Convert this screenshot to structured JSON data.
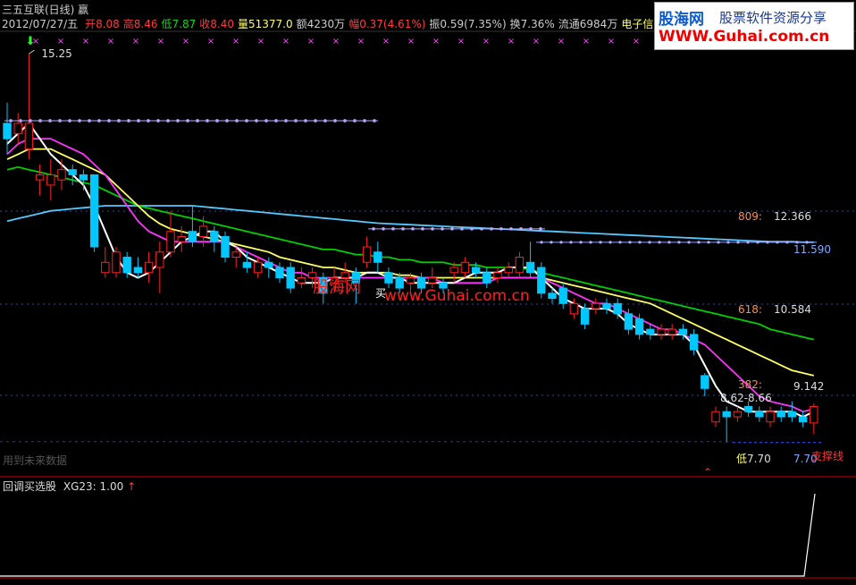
{
  "window": {
    "title": "三五互联(日线) 赢",
    "date": "2012/07/27/五"
  },
  "quote": [
    {
      "label": "开",
      "value": "8.08",
      "label_color": "#ff3b3b",
      "value_color": "#ff3b3b"
    },
    {
      "label": "高",
      "value": "8.46",
      "label_color": "#ff3b3b",
      "value_color": "#ff3b3b"
    },
    {
      "label": "低",
      "value": "7.87",
      "label_color": "#00e000",
      "value_color": "#00e000"
    },
    {
      "label": "收",
      "value": "8.40",
      "label_color": "#ff3b3b",
      "value_color": "#ff3b3b"
    },
    {
      "label": "量",
      "value": "51377.0",
      "label_color": "#ffff66",
      "value_color": "#ffff66"
    },
    {
      "label": "额",
      "value": "4230万",
      "label_color": "#cccccc",
      "value_color": "#cccccc"
    },
    {
      "label": "幅",
      "value": "0.37(4.61%)",
      "label_color": "#ff3b3b",
      "value_color": "#ff3b3b"
    },
    {
      "label": "振",
      "value": "0.59(7.35%)",
      "label_color": "#cccccc",
      "value_color": "#cccccc"
    },
    {
      "label": "换",
      "value": "7.36%",
      "label_color": "#cccccc",
      "value_color": "#cccccc"
    },
    {
      "label": "流通",
      "value": "6984万",
      "label_color": "#cccccc",
      "value_color": "#cccccc"
    },
    {
      "label": "",
      "value": "电子信息",
      "label_color": "#ffff66",
      "value_color": "#ffff66"
    }
  ],
  "watermark": {
    "site_name": "股海网",
    "slogan": "股票软件资源分享",
    "url": "WWW.Guhai.com.cn",
    "center_name": "股海网",
    "center_url": "www.Guhai.com.cn"
  },
  "main_panel": {
    "price_marks": {
      "peak": "15.25",
      "fib809_label": "809:",
      "fib809_value": "12.366",
      "level_11590": "11.590",
      "fib618_label": "618:",
      "fib618_value": "10.584",
      "fib382_label": "382:",
      "fib382_value": "9.142",
      "range_label": "8.62-8.66",
      "low_marker": "低",
      "low_value": "7.70",
      "low_value_right": "7.70",
      "buy_label": "买",
      "support_label": "支撑线",
      "future_note": "用到未来数据"
    }
  },
  "indicator_panel": {
    "name": "回调买选股",
    "series_label": "XG23:",
    "series_value": "1.00",
    "arrow": "↑"
  },
  "colors": {
    "up": "#ff2020",
    "down": "#00c8ff",
    "white_ma": "#ffffff",
    "magenta_ma": "#ff33ff",
    "yellow_ma": "#ffff66",
    "green_ma": "#00d000",
    "cyan_ma": "#55c8ff",
    "dot_line": "#b8a8ff",
    "frame": "#cc0000"
  },
  "chart_data": {
    "type": "candlestick",
    "ylim": [
      7.4,
      15.6
    ],
    "candles": [
      {
        "o": 13.9,
        "c": 13.6,
        "h": 14.3,
        "l": 13.3
      },
      {
        "o": 13.7,
        "c": 13.9,
        "h": 14.1,
        "l": 13.5
      },
      {
        "o": 13.4,
        "c": 13.9,
        "h": 15.25,
        "l": 13.2
      },
      {
        "o": 12.8,
        "c": 12.9,
        "h": 13.1,
        "l": 12.5
      },
      {
        "o": 12.7,
        "c": 12.9,
        "h": 13.2,
        "l": 12.4
      },
      {
        "o": 12.8,
        "c": 13.0,
        "h": 13.2,
        "l": 12.6
      },
      {
        "o": 13.0,
        "c": 12.9,
        "h": 13.1,
        "l": 12.7
      },
      {
        "o": 12.9,
        "c": 12.8,
        "h": 13.0,
        "l": 12.6
      },
      {
        "o": 12.9,
        "c": 11.5,
        "h": 12.9,
        "l": 11.4
      },
      {
        "o": 11.0,
        "c": 11.2,
        "h": 11.5,
        "l": 10.9
      },
      {
        "o": 11.0,
        "c": 11.4,
        "h": 11.5,
        "l": 10.9
      },
      {
        "o": 11.3,
        "c": 11.0,
        "h": 11.4,
        "l": 10.9
      },
      {
        "o": 11.1,
        "c": 11.0,
        "h": 11.3,
        "l": 10.9
      },
      {
        "o": 11.0,
        "c": 11.2,
        "h": 11.4,
        "l": 10.8
      },
      {
        "o": 11.1,
        "c": 11.4,
        "h": 11.6,
        "l": 10.6
      },
      {
        "o": 11.4,
        "c": 11.8,
        "h": 12.2,
        "l": 11.3
      },
      {
        "o": 11.6,
        "c": 11.7,
        "h": 11.9,
        "l": 11.4
      },
      {
        "o": 11.8,
        "c": 11.6,
        "h": 12.3,
        "l": 11.5
      },
      {
        "o": 11.7,
        "c": 11.9,
        "h": 12.1,
        "l": 11.5
      },
      {
        "o": 11.8,
        "c": 11.6,
        "h": 11.9,
        "l": 11.4
      },
      {
        "o": 11.7,
        "c": 11.3,
        "h": 11.8,
        "l": 11.2
      },
      {
        "o": 11.3,
        "c": 11.4,
        "h": 11.5,
        "l": 11.1
      },
      {
        "o": 11.2,
        "c": 11.1,
        "h": 11.4,
        "l": 11.0
      },
      {
        "o": 11.0,
        "c": 11.2,
        "h": 11.3,
        "l": 10.9
      },
      {
        "o": 11.2,
        "c": 11.1,
        "h": 11.3,
        "l": 10.9
      },
      {
        "o": 11.1,
        "c": 10.9,
        "h": 11.2,
        "l": 10.8
      },
      {
        "o": 11.1,
        "c": 10.7,
        "h": 11.2,
        "l": 10.6
      },
      {
        "o": 10.8,
        "c": 10.9,
        "h": 11.1,
        "l": 10.7
      },
      {
        "o": 10.9,
        "c": 11.0,
        "h": 11.1,
        "l": 10.7
      },
      {
        "o": 10.9,
        "c": 10.6,
        "h": 11.0,
        "l": 10.4
      },
      {
        "o": 10.8,
        "c": 10.9,
        "h": 11.1,
        "l": 10.6
      },
      {
        "o": 10.9,
        "c": 11.0,
        "h": 11.2,
        "l": 10.8
      },
      {
        "o": 11.0,
        "c": 10.8,
        "h": 11.1,
        "l": 10.4
      },
      {
        "o": 11.2,
        "c": 11.5,
        "h": 11.7,
        "l": 11.1
      },
      {
        "o": 11.4,
        "c": 11.2,
        "h": 11.6,
        "l": 11.0
      },
      {
        "o": 11.0,
        "c": 10.8,
        "h": 11.1,
        "l": 10.7
      },
      {
        "o": 10.9,
        "c": 10.7,
        "h": 11.0,
        "l": 10.6
      },
      {
        "o": 10.8,
        "c": 10.9,
        "h": 11.0,
        "l": 10.6
      },
      {
        "o": 10.9,
        "c": 10.7,
        "h": 11.0,
        "l": 10.6
      },
      {
        "o": 10.8,
        "c": 10.9,
        "h": 11.1,
        "l": 10.7
      },
      {
        "o": 10.8,
        "c": 10.7,
        "h": 10.9,
        "l": 10.6
      },
      {
        "o": 11.0,
        "c": 11.1,
        "h": 11.2,
        "l": 10.8
      },
      {
        "o": 11.0,
        "c": 11.2,
        "h": 11.3,
        "l": 10.9
      },
      {
        "o": 11.1,
        "c": 11.0,
        "h": 11.2,
        "l": 10.9
      },
      {
        "o": 11.0,
        "c": 10.8,
        "h": 11.1,
        "l": 10.7
      },
      {
        "o": 10.9,
        "c": 11.0,
        "h": 11.1,
        "l": 10.8
      },
      {
        "o": 11.0,
        "c": 11.1,
        "h": 11.2,
        "l": 10.9
      },
      {
        "o": 11.0,
        "c": 11.3,
        "h": 11.4,
        "l": 10.9
      },
      {
        "o": 11.2,
        "c": 11.0,
        "h": 11.6,
        "l": 10.9
      },
      {
        "o": 11.1,
        "c": 10.6,
        "h": 11.2,
        "l": 10.5
      },
      {
        "o": 10.6,
        "c": 10.5,
        "h": 10.7,
        "l": 10.4
      },
      {
        "o": 10.7,
        "c": 10.4,
        "h": 10.8,
        "l": 10.3
      },
      {
        "o": 10.2,
        "c": 10.4,
        "h": 10.5,
        "l": 10.1
      },
      {
        "o": 10.3,
        "c": 10.0,
        "h": 10.4,
        "l": 9.9
      },
      {
        "o": 10.3,
        "c": 10.4,
        "h": 10.5,
        "l": 10.2
      },
      {
        "o": 10.4,
        "c": 10.3,
        "h": 10.5,
        "l": 10.2
      },
      {
        "o": 10.4,
        "c": 10.2,
        "h": 10.5,
        "l": 10.1
      },
      {
        "o": 10.2,
        "c": 9.9,
        "h": 10.3,
        "l": 9.8
      },
      {
        "o": 10.1,
        "c": 9.8,
        "h": 10.2,
        "l": 9.7
      },
      {
        "o": 9.9,
        "c": 9.8,
        "h": 10.0,
        "l": 9.7
      },
      {
        "o": 9.8,
        "c": 9.9,
        "h": 10.0,
        "l": 9.7
      },
      {
        "o": 9.8,
        "c": 9.9,
        "h": 10.0,
        "l": 9.7
      },
      {
        "o": 9.9,
        "c": 9.8,
        "h": 10.0,
        "l": 9.7
      },
      {
        "o": 9.8,
        "c": 9.5,
        "h": 9.9,
        "l": 9.4
      },
      {
        "o": 9.0,
        "c": 8.75,
        "h": 9.05,
        "l": 8.6
      },
      {
        "o": 8.1,
        "c": 8.3,
        "h": 8.4,
        "l": 8.0
      },
      {
        "o": 8.3,
        "c": 8.2,
        "h": 8.4,
        "l": 7.7
      },
      {
        "o": 8.2,
        "c": 8.3,
        "h": 8.4,
        "l": 8.1
      },
      {
        "o": 8.4,
        "c": 8.3,
        "h": 8.5,
        "l": 8.2
      },
      {
        "o": 8.3,
        "c": 8.2,
        "h": 8.4,
        "l": 8.1
      },
      {
        "o": 8.1,
        "c": 8.3,
        "h": 8.4,
        "l": 8.0
      },
      {
        "o": 8.3,
        "c": 8.2,
        "h": 8.4,
        "l": 8.1
      },
      {
        "o": 8.3,
        "c": 8.2,
        "h": 8.5,
        "l": 8.1
      },
      {
        "o": 8.2,
        "c": 8.1,
        "h": 8.3,
        "l": 8.0
      },
      {
        "o": 8.08,
        "c": 8.4,
        "h": 8.46,
        "l": 7.87
      }
    ],
    "ma_white": [
      13.5,
      13.7,
      13.9,
      13.6,
      13.3,
      13.1,
      12.9,
      12.7,
      12.3,
      11.8,
      11.3,
      11.0,
      10.9,
      11.0,
      11.2,
      11.4,
      11.6,
      11.7,
      11.8,
      11.8,
      11.6,
      11.5,
      11.3,
      11.2,
      11.1,
      11.0,
      10.9,
      10.8,
      10.8,
      10.8,
      10.9,
      10.9,
      10.9,
      11.0,
      11.0,
      10.9,
      10.9,
      10.8,
      10.8,
      10.8,
      10.8,
      10.8,
      10.9,
      11.0,
      11.0,
      11.0,
      11.1,
      11.1,
      11.1,
      10.9,
      10.7,
      10.5,
      10.4,
      10.3,
      10.3,
      10.3,
      10.2,
      10.0,
      9.9,
      9.8,
      9.8,
      9.8,
      9.8,
      9.6,
      9.2,
      8.8,
      8.5,
      8.4,
      8.3,
      8.3,
      8.3,
      8.3,
      8.3,
      8.2,
      8.3
    ],
    "ma_magenta": [
      13.3,
      13.5,
      13.6,
      13.6,
      13.6,
      13.5,
      13.4,
      13.3,
      13.1,
      12.9,
      12.6,
      12.3,
      12.0,
      11.8,
      11.7,
      11.6,
      11.6,
      11.6,
      11.6,
      11.6,
      11.6,
      11.5,
      11.4,
      11.3,
      11.2,
      11.1,
      11.0,
      11.0,
      10.9,
      10.9,
      10.9,
      10.9,
      10.9,
      10.9,
      10.9,
      10.9,
      10.9,
      10.9,
      10.9,
      10.9,
      10.8,
      10.8,
      10.8,
      10.8,
      10.8,
      10.9,
      10.9,
      10.9,
      10.9,
      10.9,
      10.8,
      10.7,
      10.6,
      10.5,
      10.4,
      10.4,
      10.3,
      10.2,
      10.1,
      10.0,
      9.9,
      9.9,
      9.8,
      9.7,
      9.6,
      9.4,
      9.2,
      9.0,
      8.8,
      8.6,
      8.5,
      8.45,
      8.4,
      8.3,
      8.35
    ],
    "ma_yellow": [
      13.2,
      13.3,
      13.4,
      13.4,
      13.4,
      13.3,
      13.2,
      13.1,
      13.0,
      12.9,
      12.7,
      12.5,
      12.3,
      12.1,
      11.95,
      11.85,
      11.8,
      11.75,
      11.7,
      11.65,
      11.6,
      11.55,
      11.5,
      11.45,
      11.4,
      11.3,
      11.25,
      11.2,
      11.15,
      11.1,
      11.1,
      11.05,
      11.0,
      11.0,
      11.0,
      11.0,
      10.95,
      10.95,
      10.9,
      10.9,
      10.9,
      10.9,
      10.9,
      10.9,
      10.9,
      10.9,
      10.9,
      10.9,
      10.9,
      10.9,
      10.85,
      10.8,
      10.75,
      10.7,
      10.65,
      10.6,
      10.55,
      10.5,
      10.45,
      10.4,
      10.3,
      10.2,
      10.1,
      10.0,
      9.9,
      9.8,
      9.7,
      9.6,
      9.5,
      9.4,
      9.3,
      9.2,
      9.1,
      9.05,
      9.0
    ],
    "ma_green": [
      13.0,
      13.05,
      13.0,
      12.95,
      12.9,
      12.85,
      12.8,
      12.75,
      12.7,
      12.6,
      12.5,
      12.4,
      12.3,
      12.25,
      12.2,
      12.15,
      12.1,
      12.05,
      12.0,
      11.95,
      11.9,
      11.85,
      11.8,
      11.75,
      11.7,
      11.65,
      11.6,
      11.55,
      11.5,
      11.45,
      11.45,
      11.4,
      11.35,
      11.35,
      11.3,
      11.3,
      11.25,
      11.25,
      11.2,
      11.2,
      11.2,
      11.15,
      11.15,
      11.15,
      11.1,
      11.1,
      11.1,
      11.1,
      11.05,
      11.0,
      10.95,
      10.9,
      10.85,
      10.8,
      10.75,
      10.7,
      10.65,
      10.6,
      10.55,
      10.5,
      10.45,
      10.4,
      10.35,
      10.3,
      10.25,
      10.2,
      10.15,
      10.1,
      10.05,
      10.0,
      9.9,
      9.85,
      9.8,
      9.75,
      9.7
    ],
    "ma_cyan": [
      12.0,
      12.05,
      12.1,
      12.15,
      12.2,
      12.22,
      12.24,
      12.26,
      12.28,
      12.3,
      12.3,
      12.3,
      12.3,
      12.3,
      12.3,
      12.3,
      12.3,
      12.3,
      12.28,
      12.26,
      12.24,
      12.22,
      12.2,
      12.18,
      12.16,
      12.14,
      12.12,
      12.1,
      12.08,
      12.06,
      12.04,
      12.02,
      12.0,
      11.98,
      11.96,
      11.95,
      11.94,
      11.93,
      11.92,
      11.91,
      11.9,
      11.89,
      11.88,
      11.87,
      11.86,
      11.85,
      11.84,
      11.83,
      11.82,
      11.81,
      11.8,
      11.79,
      11.78,
      11.77,
      11.76,
      11.75,
      11.74,
      11.73,
      11.72,
      11.71,
      11.7,
      11.69,
      11.68,
      11.67,
      11.66,
      11.65,
      11.64,
      11.63,
      11.62,
      11.61,
      11.6,
      11.6,
      11.6,
      11.59,
      11.59
    ],
    "levels": [
      12.366,
      11.59,
      10.584,
      9.142,
      7.7
    ],
    "indicator": {
      "name": "XG23",
      "values_tail": [
        0,
        1.0
      ]
    }
  }
}
